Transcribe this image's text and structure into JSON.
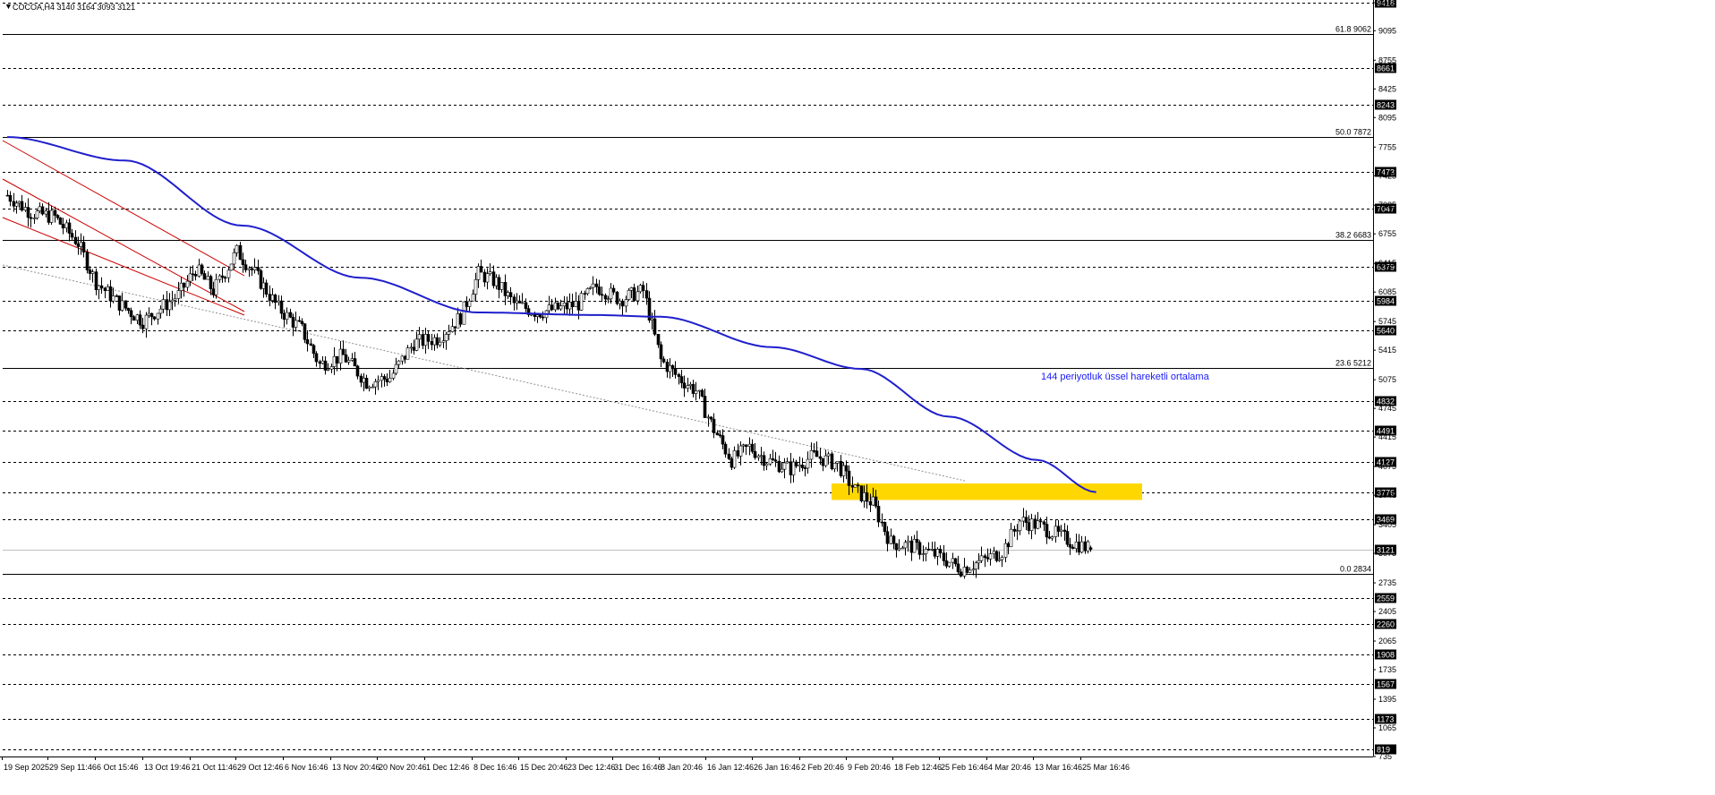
{
  "header": {
    "symbol_line": "COCOA,H4  3140 3164 3093 3121"
  },
  "chart_data": {
    "type": "candlestick",
    "symbol": "COCOA",
    "timeframe": "H4",
    "ohlc_header": {
      "open": 3140,
      "high": 3164,
      "low": 3093,
      "close": 3121
    },
    "ylim": [
      735,
      9418
    ],
    "y_ticks": [
      "9418",
      "9095",
      "8755",
      "8425",
      "8095",
      "7755",
      "7425",
      "7085",
      "6755",
      "6415",
      "6085",
      "5745",
      "5415",
      "5075",
      "4745",
      "4415",
      "4075",
      "3745",
      "3405",
      "3075",
      "2735",
      "2405",
      "2065",
      "1735",
      "1395",
      "1065",
      "735"
    ],
    "x_tick_labels": [
      "19 Sep 2025",
      "29 Sep 11:46",
      "6 Oct 15:46",
      "13 Oct 19:46",
      "21 Oct 11:46",
      "29 Oct 12:46",
      "6 Nov 16:46",
      "13 Nov 20:46",
      "20 Nov 20:46",
      "1 Dec 12:46",
      "8 Dec 16:46",
      "15 Dec 20:46",
      "23 Dec 12:46",
      "31 Dec 16:46",
      "8 Jan 20:46",
      "16 Jan 12:46",
      "26 Jan 16:46",
      "2 Feb 20:46",
      "9 Feb 20:46",
      "18 Feb 12:46",
      "25 Feb 16:46",
      "4 Mar 20:46",
      "13 Mar 16:46",
      "25 Mar 16:46"
    ],
    "horizontal_levels": [
      {
        "value": 9418,
        "label": "9418",
        "style": "dashed"
      },
      {
        "value": 8661,
        "label": "8661",
        "style": "dashed"
      },
      {
        "value": 8243,
        "label": "8243",
        "style": "dashed"
      },
      {
        "value": 7473,
        "label": "7473",
        "style": "dashed"
      },
      {
        "value": 7047,
        "label": "7047",
        "style": "dashed"
      },
      {
        "value": 6379,
        "label": "6379",
        "style": "dashed"
      },
      {
        "value": 5984,
        "label": "5984",
        "style": "dashed"
      },
      {
        "value": 5640,
        "label": "5640",
        "style": "dashed"
      },
      {
        "value": 4832,
        "label": "4832",
        "style": "dashed"
      },
      {
        "value": 4491,
        "label": "4491",
        "style": "dashed"
      },
      {
        "value": 4127,
        "label": "4127",
        "style": "dashed"
      },
      {
        "value": 3776,
        "label": "3776",
        "style": "dashed"
      },
      {
        "value": 3469,
        "label": "3469",
        "style": "dashed"
      },
      {
        "value": 2559,
        "label": "2559",
        "style": "dashed"
      },
      {
        "value": 2260,
        "label": "2260",
        "style": "dashed"
      },
      {
        "value": 1908,
        "label": "1908",
        "style": "dashed"
      },
      {
        "value": 1567,
        "label": "1567",
        "style": "dashed"
      },
      {
        "value": 1173,
        "label": "1173",
        "style": "dashed"
      },
      {
        "value": 819,
        "label": "819",
        "style": "dashed"
      }
    ],
    "fibonacci_levels": [
      {
        "value": 9062,
        "label": "61.8 9062"
      },
      {
        "value": 7872,
        "label": "50.0 7872"
      },
      {
        "value": 6683,
        "label": "38.2 6683"
      },
      {
        "value": 5212,
        "label": "23.6 5212"
      },
      {
        "value": 2834,
        "label": "0.0 2834"
      }
    ],
    "current_price": {
      "value": 3121,
      "label": "3121"
    },
    "annotation": {
      "text": "144 periyotluk üssel hareketli ortalama",
      "color": "#1a1aff"
    },
    "zone": {
      "value_top": 3880,
      "value_bottom": 3690,
      "color": "#ffd700"
    },
    "ema_color": "#1f1fcc",
    "channel_color": "#cc0000",
    "close_path": [
      {
        "i": 0,
        "c": 7200
      },
      {
        "i": 8,
        "c": 7000
      },
      {
        "i": 16,
        "c": 6950
      },
      {
        "i": 24,
        "c": 6650
      },
      {
        "i": 30,
        "c": 6200
      },
      {
        "i": 38,
        "c": 5950
      },
      {
        "i": 46,
        "c": 5750
      },
      {
        "i": 52,
        "c": 5900
      },
      {
        "i": 58,
        "c": 6050
      },
      {
        "i": 64,
        "c": 6350
      },
      {
        "i": 70,
        "c": 6100
      },
      {
        "i": 78,
        "c": 6550
      },
      {
        "i": 84,
        "c": 6300
      },
      {
        "i": 92,
        "c": 5900
      },
      {
        "i": 100,
        "c": 5650
      },
      {
        "i": 106,
        "c": 5250
      },
      {
        "i": 114,
        "c": 5350
      },
      {
        "i": 122,
        "c": 5050
      },
      {
        "i": 130,
        "c": 5100
      },
      {
        "i": 138,
        "c": 5500
      },
      {
        "i": 146,
        "c": 5550
      },
      {
        "i": 154,
        "c": 5800
      },
      {
        "i": 160,
        "c": 6300
      },
      {
        "i": 166,
        "c": 6200
      },
      {
        "i": 172,
        "c": 5950
      },
      {
        "i": 180,
        "c": 5850
      },
      {
        "i": 188,
        "c": 5900
      },
      {
        "i": 194,
        "c": 5950
      },
      {
        "i": 200,
        "c": 6150
      },
      {
        "i": 208,
        "c": 6000
      },
      {
        "i": 216,
        "c": 6100
      },
      {
        "i": 222,
        "c": 5300
      },
      {
        "i": 228,
        "c": 5100
      },
      {
        "i": 234,
        "c": 4950
      },
      {
        "i": 240,
        "c": 4500
      },
      {
        "i": 246,
        "c": 4150
      },
      {
        "i": 252,
        "c": 4300
      },
      {
        "i": 258,
        "c": 4150
      },
      {
        "i": 266,
        "c": 4050
      },
      {
        "i": 274,
        "c": 4200
      },
      {
        "i": 282,
        "c": 4100
      },
      {
        "i": 288,
        "c": 3800
      },
      {
        "i": 294,
        "c": 3650
      },
      {
        "i": 300,
        "c": 3200
      },
      {
        "i": 308,
        "c": 3150
      },
      {
        "i": 316,
        "c": 3050
      },
      {
        "i": 324,
        "c": 2900
      },
      {
        "i": 332,
        "c": 3000
      },
      {
        "i": 338,
        "c": 3100
      },
      {
        "i": 344,
        "c": 3450
      },
      {
        "i": 350,
        "c": 3400
      },
      {
        "i": 356,
        "c": 3300
      },
      {
        "i": 362,
        "c": 3200
      },
      {
        "i": 368,
        "c": 3121
      }
    ],
    "ema_path": [
      {
        "i": 0,
        "v": 7870
      },
      {
        "i": 40,
        "v": 7600
      },
      {
        "i": 80,
        "v": 6850
      },
      {
        "i": 120,
        "v": 6250
      },
      {
        "i": 160,
        "v": 5850
      },
      {
        "i": 200,
        "v": 5820
      },
      {
        "i": 222,
        "v": 5800
      },
      {
        "i": 260,
        "v": 5450
      },
      {
        "i": 290,
        "v": 5200
      },
      {
        "i": 320,
        "v": 4650
      },
      {
        "i": 350,
        "v": 4150
      },
      {
        "i": 370,
        "v": 3780
      }
    ]
  }
}
